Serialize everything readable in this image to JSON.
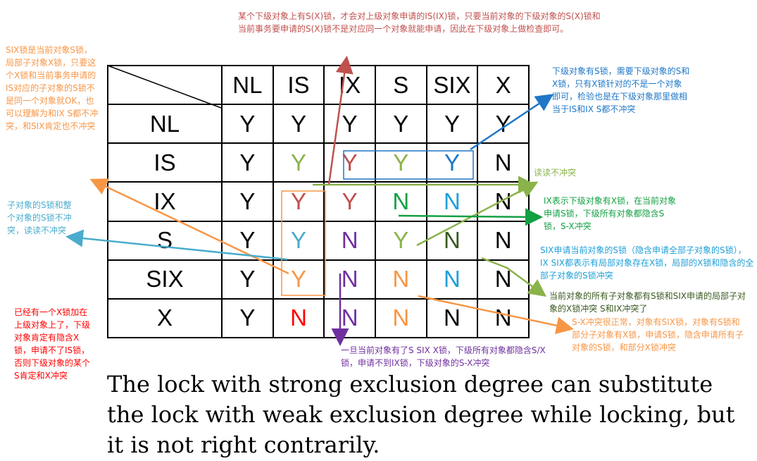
{
  "colors": {
    "black": "#000000",
    "green_cell": "#8ab34a",
    "dark_green_cell": "#13a044",
    "red_cell": "#c0504d",
    "blue_cell": "#1f77c7",
    "teal_cell": "#4aaccc",
    "orange_cell": "#f79646",
    "purple_cell": "#7030a0",
    "bright_red": "#ff0000"
  },
  "matrix": {
    "header": [
      "NL",
      "IS",
      "IX",
      "S",
      "SIX",
      "X"
    ],
    "rows": [
      {
        "label": "NL",
        "cells": [
          {
            "v": "Y",
            "c": "#000000"
          },
          {
            "v": "Y",
            "c": "#000000"
          },
          {
            "v": "Y",
            "c": "#000000"
          },
          {
            "v": "Y",
            "c": "#000000"
          },
          {
            "v": "Y",
            "c": "#000000"
          },
          {
            "v": "Y",
            "c": "#000000"
          }
        ]
      },
      {
        "label": "IS",
        "cells": [
          {
            "v": "Y",
            "c": "#000000"
          },
          {
            "v": "Y",
            "c": "#8ab34a"
          },
          {
            "v": "Y",
            "c": "#c0504d"
          },
          {
            "v": "Y",
            "c": "#8ab34a"
          },
          {
            "v": "Y",
            "c": "#1f77c7"
          },
          {
            "v": "N",
            "c": "#000000"
          }
        ]
      },
      {
        "label": "IX",
        "cells": [
          {
            "v": "Y",
            "c": "#000000"
          },
          {
            "v": "Y",
            "c": "#c0504d"
          },
          {
            "v": "Y",
            "c": "#c0504d"
          },
          {
            "v": "N",
            "c": "#13a044"
          },
          {
            "v": "N",
            "c": "#1f9fd8"
          },
          {
            "v": "N",
            "c": "#000000"
          }
        ]
      },
      {
        "label": "S",
        "cells": [
          {
            "v": "Y",
            "c": "#000000"
          },
          {
            "v": "Y",
            "c": "#4aaccc"
          },
          {
            "v": "N",
            "c": "#7030a0"
          },
          {
            "v": "Y",
            "c": "#8ab34a"
          },
          {
            "v": "N",
            "c": "#3a5a20"
          },
          {
            "v": "N",
            "c": "#000000"
          }
        ]
      },
      {
        "label": "SIX",
        "cells": [
          {
            "v": "Y",
            "c": "#000000"
          },
          {
            "v": "Y",
            "c": "#f79646"
          },
          {
            "v": "N",
            "c": "#7030a0"
          },
          {
            "v": "N",
            "c": "#f79646"
          },
          {
            "v": "N",
            "c": "#1f9fd8"
          },
          {
            "v": "N",
            "c": "#000000"
          }
        ]
      },
      {
        "label": "X",
        "cells": [
          {
            "v": "Y",
            "c": "#000000"
          },
          {
            "v": "N",
            "c": "#ff0000"
          },
          {
            "v": "N",
            "c": "#7030a0"
          },
          {
            "v": "N",
            "c": "#f79646"
          },
          {
            "v": "N",
            "c": "#000000"
          },
          {
            "v": "N",
            "c": "#000000"
          }
        ]
      }
    ]
  },
  "notes": {
    "top_red": "某个下级对象上有S(X)锁，才会对上级对象申请的IS(IX)锁，只要当前对象的下级对象的S(X)锁和当前事务要申请的S(X)锁不是对应同一个对象就能申请，因此在下级对象上做检查即可。",
    "left_orange": "SIX锁是当前对象S锁，局部子对象X锁，只要这个X锁和当前事务申请的IS对应的子对象的S锁不是同一个对象就OK，也可以理解为和IX S都不冲突，和SIX肯定也不冲突",
    "left_teal": "子对象的S锁和整个对象的S锁不冲突，读读不冲突",
    "left_red": "已经有一个X锁加在上级对象上了，下级对象肯定有隐含X锁，申请不了IS锁，否则下级对象的某个S肯定和X冲突",
    "right_blue": "下级对象有S锁，需要下级对象的S和X锁，只有X锁针对的不是一个对象即可，检验也是在下级对象那里做相当于IS和IX S都不冲突",
    "right_green_light": "读读不冲突",
    "right_green_dark": "IX表示下级对象有X锁，在当前对象申请S锁，下级所有对象都隐含S锁，S-X冲突",
    "right_blue2": "SIX申请当前对象的S锁（隐含申请全部子对象的S锁），IX SIX都表示有局部对象存在X锁，局部的X锁和隐含的全部子对象的S锁冲突",
    "right_olive": "当前对象的所有子对象都有S锁和SIX申请的局部子对象的X锁冲突 S和IX冲突了",
    "right_orange": "S-X冲突很正常，对象有SIX锁，对象有S锁和部分子对象有X锁，申请S锁，隐含申请所有子对象的S锁，和部分X锁冲突",
    "bottom_purple": "一旦当前对象有了S SIX X锁，下级所有对象都隐含S/X锁，申请不到IX锁，下级对象的S-X冲突"
  },
  "bottom_text": "The  lock with strong exclusion degree can substitute the lock with weak exclusion degree while locking, but it is not right contrarily."
}
